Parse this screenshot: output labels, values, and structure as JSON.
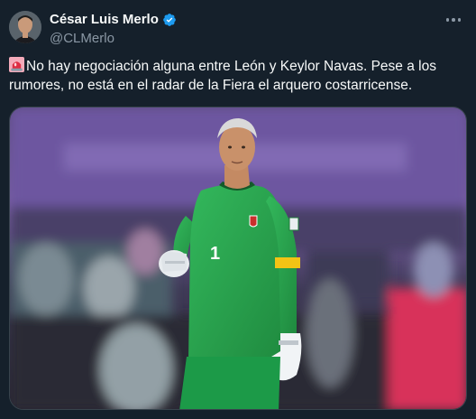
{
  "author": {
    "display_name": "César Luis Merlo",
    "handle": "@CLMerlo",
    "verified": true,
    "avatar_icon": "profile-photo"
  },
  "tweet": {
    "emoji_icon": "police-car-light-icon",
    "text": "No hay negociación alguna entre León y Keylor Navas. Pese a los rumores, no está en el radar de la Fiera el arquero costarricense."
  },
  "media": {
    "kind": "photo",
    "jersey_number": "1"
  },
  "colors": {
    "background": "#15202b",
    "text": "#f7f9f9",
    "secondary_text": "#8b98a5",
    "verified_blue": "#1d9bf0",
    "jersey_green": "#2fae54"
  }
}
